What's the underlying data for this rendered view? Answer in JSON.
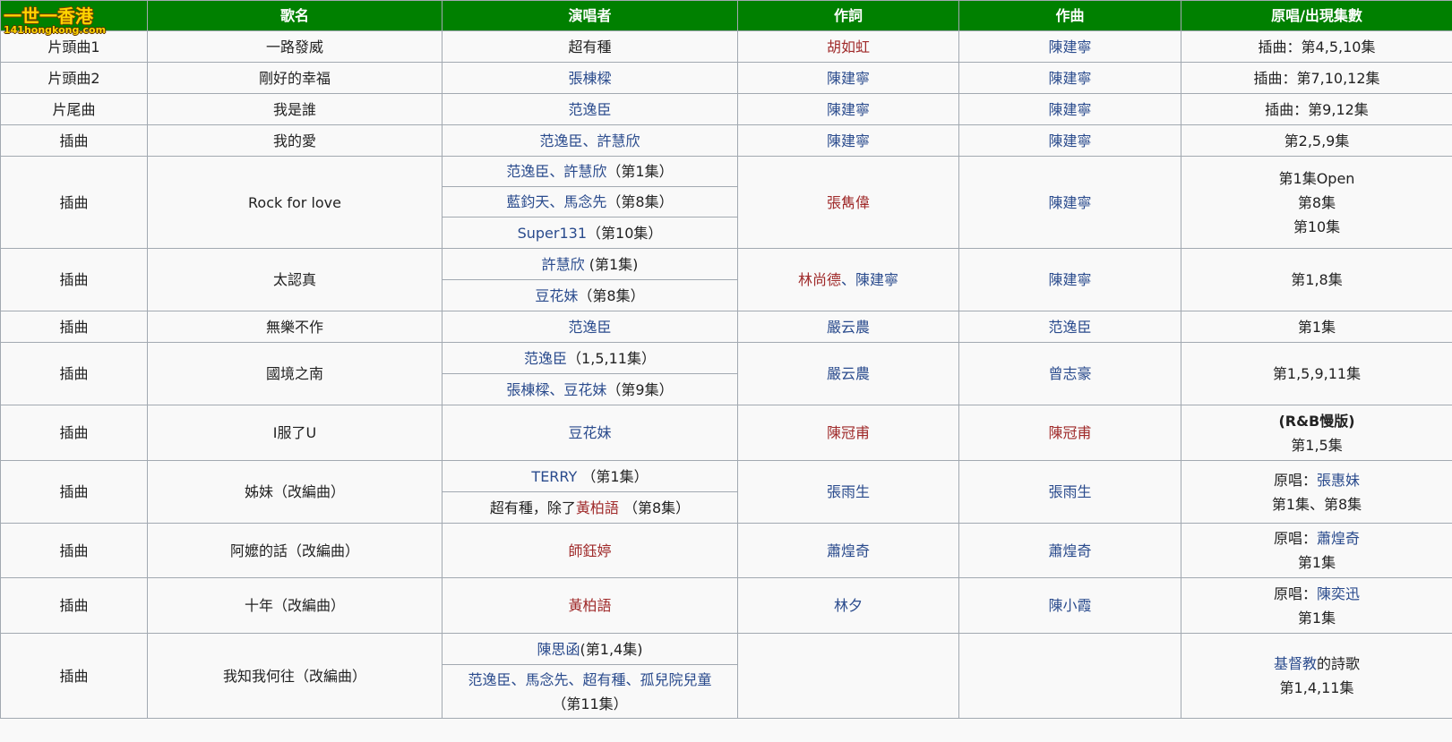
{
  "logo": {
    "main": "一世一香港",
    "url": "141hongkong.com"
  },
  "headers": [
    "",
    "歌名",
    "演唱者",
    "作詞",
    "作曲",
    "原唱/出現集數"
  ],
  "rows": {
    "r1": {
      "type": "片頭曲1",
      "title": "一路發威",
      "singer": "超有種",
      "lyricist": "胡如虹",
      "composer": "陳建寧",
      "note": "插曲：第4,5,10集"
    },
    "r2": {
      "type": "片頭曲2",
      "title": "剛好的幸福",
      "singer": "張棟樑",
      "lyricist": "陳建寧",
      "composer": "陳建寧",
      "note": "插曲：第7,10,12集"
    },
    "r3": {
      "type": "片尾曲",
      "title": "我是誰",
      "singer": "范逸臣",
      "lyricist": "陳建寧",
      "composer": "陳建寧",
      "note": "插曲：第9,12集"
    },
    "r4": {
      "type": "插曲",
      "title": "我的愛",
      "singer_a": "范逸臣",
      "singer_b": "許慧欣",
      "sep": "、",
      "lyricist": "陳建寧",
      "composer": "陳建寧",
      "note": "第2,5,9集"
    },
    "r5": {
      "type": "插曲",
      "title": "Rock for love",
      "s1_a": "范逸臣",
      "s1_b": "許慧欣",
      "s1_ep": "（第1集）",
      "s2_a": "藍鈞天",
      "s2_b": "馬念先",
      "s2_ep": "（第8集）",
      "s3_a": "Super131",
      "s3_ep": "（第10集）",
      "lyricist": "張雋偉",
      "composer": "陳建寧",
      "note1": "第1集Open",
      "note2": "第8集",
      "note3": "第10集"
    },
    "r6": {
      "type": "插曲",
      "title": "太認真",
      "s1_a": "許慧欣",
      "s1_ep": " (第1集)",
      "s2_a": "豆花妹",
      "s2_ep": "（第8集）",
      "lyricist_a": "林尚德",
      "lyricist_b": "陳建寧",
      "composer": "陳建寧",
      "note": "第1,8集"
    },
    "r7": {
      "type": "插曲",
      "title": "無樂不作",
      "singer": "范逸臣",
      "lyricist": "嚴云農",
      "composer": "范逸臣",
      "note": "第1集"
    },
    "r8": {
      "type": "插曲",
      "title": "國境之南",
      "s1_a": "范逸臣",
      "s1_ep": "（1,5,11集）",
      "s2_a": "張棟樑",
      "s2_b": "豆花妹",
      "s2_ep": "（第9集）",
      "lyricist": "嚴云農",
      "composer": "曾志豪",
      "note": "第1,5,9,11集"
    },
    "r9": {
      "type": "插曲",
      "title": "I服了U",
      "singer": "豆花妹",
      "lyricist": "陳冠甫",
      "composer": "陳冠甫",
      "note_bold": "(R&B慢版)",
      "note": "第1,5集"
    },
    "r10": {
      "type": "插曲",
      "title": "姊妹（改編曲）",
      "s1_a": "TERRY",
      "s1_ep": " （第1集）",
      "s2_pre": "超有種，除了",
      "s2_a": "黃柏語",
      "s2_ep": " （第8集）",
      "lyricist": "張雨生",
      "composer": "張雨生",
      "note_pre": "原唱：",
      "note_link": "張惠妹",
      "note2": "第1集、第8集"
    },
    "r11": {
      "type": "插曲",
      "title": "阿嬤的話（改編曲）",
      "singer": "師鈺婷",
      "lyricist": "蕭煌奇",
      "composer": "蕭煌奇",
      "note_pre": "原唱：",
      "note_link": "蕭煌奇",
      "note2": "第1集"
    },
    "r12": {
      "type": "插曲",
      "title": "十年（改編曲）",
      "singer": "黃柏語",
      "lyricist": "林夕",
      "composer": "陳小霞",
      "note_pre": "原唱：",
      "note_link": "陳奕迅",
      "note2": "第1集"
    },
    "r13": {
      "type": "插曲",
      "title": "我知我何往（改編曲）",
      "s1_a": "陳思函",
      "s1_ep": "(第1,4集)",
      "s2_a": "范逸臣",
      "s2_b": "馬念先",
      "s2_c": "超有種",
      "s2_d": "孤兒院兒童",
      "s2_ep": "（第11集）",
      "note_link": "基督教",
      "note_post": "的詩歌",
      "note2": "第1,4,11集"
    }
  }
}
